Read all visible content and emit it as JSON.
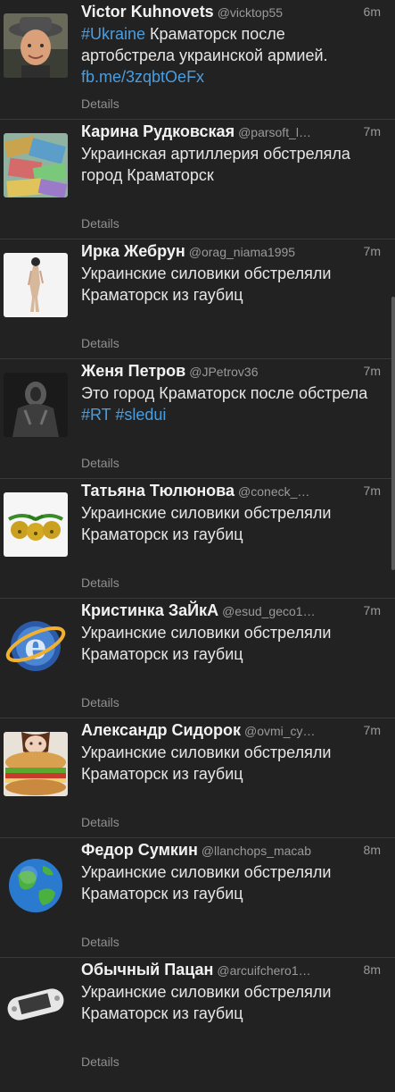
{
  "feed": {
    "tweets": [
      {
        "name": "Victor Kuhnovets",
        "handle": "@vicktop55",
        "time": "6m",
        "text_parts": [
          "#Ukraine",
          " Краматорск после артобстрела украинской армией. ",
          "fb.me/3zqbtOeFx"
        ],
        "details": "Details",
        "avatar": "man-in-hat-avatar"
      },
      {
        "name": "Карина Рудковская",
        "handle": "@parsoft_l…",
        "time": "7m",
        "text": "Украинская артиллерия обстреляла город Краматорск",
        "details": "Details",
        "avatar": "money-avatar"
      },
      {
        "name": "Ирка Жебрун",
        "handle": "@orag_niama1995",
        "time": "7m",
        "text": "Украинские силовики обстреляли Краматорск из гаубиц",
        "details": "Details",
        "avatar": "figure-avatar"
      },
      {
        "name": "Женя Петров",
        "handle": "@JPetrov36",
        "time": "7m",
        "text_parts": [
          "Это город Краматорск после обстрела ",
          "#RT",
          " ",
          "#sledui"
        ],
        "details": "Details",
        "avatar": "dark-figure-avatar"
      },
      {
        "name": "Татьяна Тюлюнова",
        "handle": "@coneck_…",
        "time": "7m",
        "text": "Украинские силовики обстреляли Краматорск из гаубиц",
        "details": "Details",
        "avatar": "bells-avatar"
      },
      {
        "name": "Кристинка ЗаЙкА",
        "handle": "@esud_geco1…",
        "time": "7m",
        "text": "Украинские силовики обстреляли Краматорск из гаубиц",
        "details": "Details",
        "avatar": "ie-logo-avatar"
      },
      {
        "name": "Александр Сидорок",
        "handle": "@ovmi_cy…",
        "time": "7m",
        "text": "Украинские силовики обстреляли Краматорск из гаубиц",
        "details": "Details",
        "avatar": "sandwich-avatar"
      },
      {
        "name": "Федор Сумкин",
        "handle": "@llanchops_macab",
        "time": "8m",
        "text": "Украинские силовики обстреляли Краматорск из гаубиц",
        "details": "Details",
        "avatar": "globe-avatar"
      },
      {
        "name": "Обычный Пацан",
        "handle": "@arcuifchero1…",
        "time": "8m",
        "text": "Украинские силовики обстреляли Краматорск из гаубиц",
        "details": "Details",
        "avatar": "psp-avatar"
      }
    ]
  },
  "colors": {
    "background": "#222222",
    "link": "#4a9ee0",
    "divider": "#3a3a3a"
  }
}
